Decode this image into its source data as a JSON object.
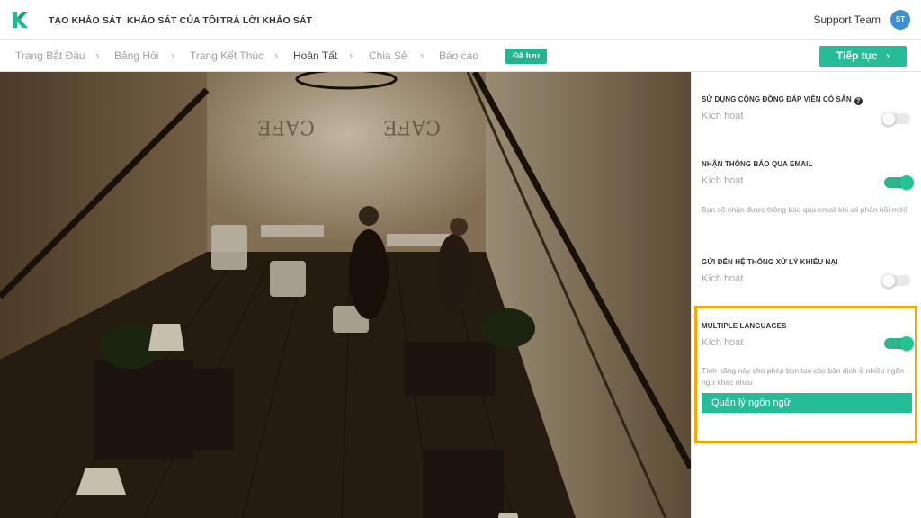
{
  "header": {
    "nav": [
      "TẠO KHẢO SÁT",
      "KHẢO SÁT CỦA TÔI",
      "TRẢ LỜI KHẢO SÁT"
    ],
    "user_name": "Support Team",
    "avatar_initials": "ST",
    "logo_icon": "k-logo-icon"
  },
  "steps": {
    "items": [
      "Trang Bắt Đầu",
      "Bảng Hỏi",
      "Trang Kết Thúc",
      "Hoàn Tất",
      "Chia Sẻ",
      "Báo cáo"
    ],
    "active": "Hoàn Tất",
    "saved_badge": "Đã lưu",
    "next_button": "Tiếp tục",
    "next_icon": "chevron-right-icon"
  },
  "settings": {
    "community": {
      "title": "SỬ DỤNG CỘNG ĐỒNG ĐÁP VIÊN CÓ SẴN",
      "label": "Kích hoạt",
      "enabled": false
    },
    "email": {
      "title": "NHẬN THÔNG BÁO QUA EMAIL",
      "label": "Kích hoạt",
      "enabled": true,
      "description": "Bạn sẽ nhận được thông báo qua email khi có phản hồi mới!"
    },
    "complaints": {
      "title": "GỬI ĐẾN HỆ THỐNG XỬ LÝ KHIẾU NẠI",
      "label": "Kích hoạt",
      "enabled": false
    },
    "languages": {
      "title": "MULTIPLE LANGUAGES",
      "label": "Kích hoạt",
      "enabled": true,
      "description": "Tính năng này cho phép bạn tạo các bản dịch ở nhiều ngôn ngữ khác nhau",
      "button": "Quản lý ngôn ngữ"
    }
  },
  "colors": {
    "accent": "#26bc97",
    "highlight": "#f7a800",
    "avatar": "#3a8fd6"
  }
}
